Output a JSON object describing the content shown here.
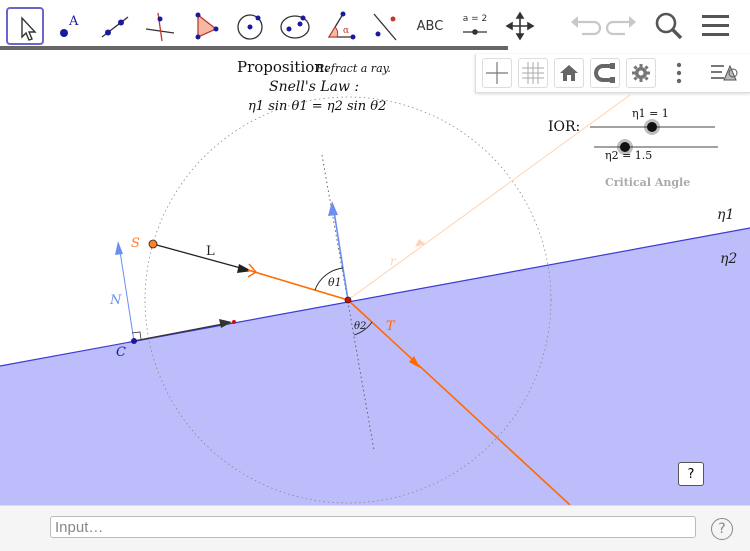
{
  "toolbar": {
    "tools": [
      {
        "name": "move-tool"
      },
      {
        "name": "point-tool",
        "glyph": "A"
      },
      {
        "name": "line-tool"
      },
      {
        "name": "perpendicular-line-tool"
      },
      {
        "name": "polygon-tool"
      },
      {
        "name": "circle-center-point-tool"
      },
      {
        "name": "ellipse-tool"
      },
      {
        "name": "angle-tool",
        "glyph": "α"
      },
      {
        "name": "reflect-tool"
      },
      {
        "name": "text-tool",
        "label": "ABC"
      },
      {
        "name": "slider-tool",
        "label": "a = 2"
      },
      {
        "name": "move-graphics-view-tool"
      }
    ],
    "undo_icon": "undo-icon",
    "redo_icon": "redo-icon",
    "search_icon": "search-icon",
    "menu_icon": "menu-icon"
  },
  "construction": {
    "proposition_label": "Proposition:",
    "proposition_text": "Refract a ray.",
    "law_title": "Snell's Law :",
    "law_formula": "η1 sin θ1 = η2 sin θ2",
    "labels": {
      "S": "S",
      "L": "L",
      "N": "N",
      "C": "C",
      "T": "T",
      "theta1": "θ1",
      "theta2": "θ2",
      "eta1": "η1",
      "eta2": "η2"
    },
    "colors": {
      "medium2": "#bdbdfb",
      "interface": "#3b3bd6",
      "ray": "#ff6a00",
      "normal": "#6b8ff0",
      "dark": "#222222"
    }
  },
  "ior": {
    "label": "IOR:",
    "slider1_label": "η1 = 1",
    "slider2_label": "η2 = 1.5",
    "critical_angle_label": "Critical Angle"
  },
  "style_bar": {
    "buttons": [
      "axes-icon",
      "grid-icon",
      "home-icon",
      "magnet-icon",
      "gear-icon",
      "more-icon"
    ],
    "toggle_icon": "style-bar-toggle-icon"
  },
  "input_bar": {
    "placeholder": "Input…",
    "help_label": "?"
  },
  "help_button_label": "?"
}
